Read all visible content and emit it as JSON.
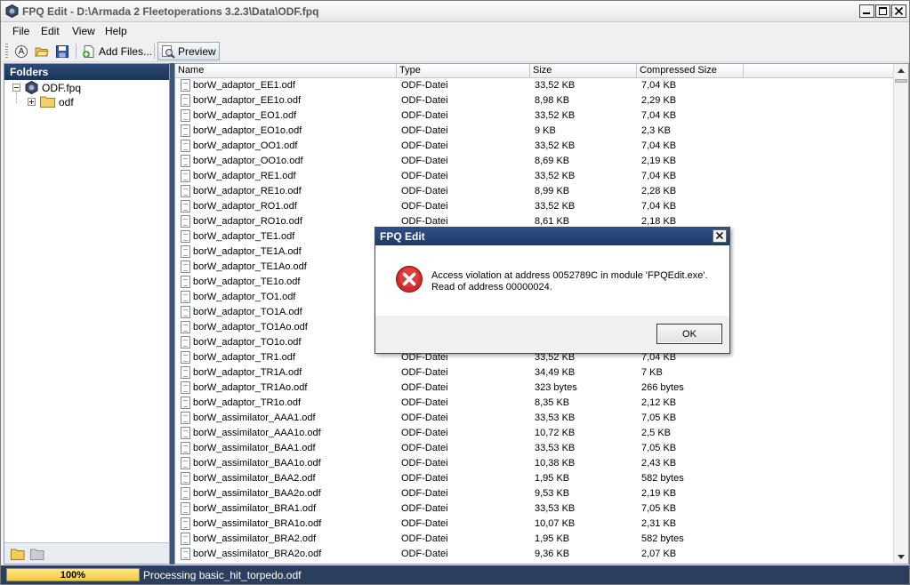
{
  "window": {
    "title": "FPQ Edit - D:\\Armada 2 Fleetoperations 3.2.3\\Data\\ODF.fpq"
  },
  "menu": [
    "File",
    "Edit",
    "View",
    "Help"
  ],
  "toolbar": {
    "add_files_label": "Add Files...",
    "preview_label": "Preview"
  },
  "folders": {
    "header": "Folders",
    "root_label": "ODF.fpq",
    "child_label": "odf"
  },
  "list": {
    "columns": [
      "Name",
      "Type",
      "Size",
      "Compressed Size"
    ],
    "rows": [
      [
        "borW_adaptor_EE1.odf",
        "ODF-Datei",
        "33,52 KB",
        "7,04 KB"
      ],
      [
        "borW_adaptor_EE1o.odf",
        "ODF-Datei",
        "8,98 KB",
        "2,29 KB"
      ],
      [
        "borW_adaptor_EO1.odf",
        "ODF-Datei",
        "33,52 KB",
        "7,04 KB"
      ],
      [
        "borW_adaptor_EO1o.odf",
        "ODF-Datei",
        "9 KB",
        "2,3 KB"
      ],
      [
        "borW_adaptor_OO1.odf",
        "ODF-Datei",
        "33,52 KB",
        "7,04 KB"
      ],
      [
        "borW_adaptor_OO1o.odf",
        "ODF-Datei",
        "8,69 KB",
        "2,19 KB"
      ],
      [
        "borW_adaptor_RE1.odf",
        "ODF-Datei",
        "33,52 KB",
        "7,04 KB"
      ],
      [
        "borW_adaptor_RE1o.odf",
        "ODF-Datei",
        "8,99 KB",
        "2,28 KB"
      ],
      [
        "borW_adaptor_RO1.odf",
        "ODF-Datei",
        "33,52 KB",
        "7,04 KB"
      ],
      [
        "borW_adaptor_RO1o.odf",
        "ODF-Datei",
        "8,61 KB",
        "2,18 KB"
      ],
      [
        "borW_adaptor_TE1.odf",
        "",
        "",
        ""
      ],
      [
        "borW_adaptor_TE1A.odf",
        "",
        "",
        ""
      ],
      [
        "borW_adaptor_TE1Ao.odf",
        "",
        "",
        ""
      ],
      [
        "borW_adaptor_TE1o.odf",
        "",
        "",
        ""
      ],
      [
        "borW_adaptor_TO1.odf",
        "",
        "",
        ""
      ],
      [
        "borW_adaptor_TO1A.odf",
        "",
        "",
        ""
      ],
      [
        "borW_adaptor_TO1Ao.odf",
        "",
        "",
        ""
      ],
      [
        "borW_adaptor_TO1o.odf",
        "",
        "",
        ""
      ],
      [
        "borW_adaptor_TR1.odf",
        "ODF-Datei",
        "33,52 KB",
        "7,04 KB"
      ],
      [
        "borW_adaptor_TR1A.odf",
        "ODF-Datei",
        "34,49 KB",
        "7 KB"
      ],
      [
        "borW_adaptor_TR1Ao.odf",
        "ODF-Datei",
        "323 bytes",
        "266 bytes"
      ],
      [
        "borW_adaptor_TR1o.odf",
        "ODF-Datei",
        "8,35 KB",
        "2,12 KB"
      ],
      [
        "borW_assimilator_AAA1.odf",
        "ODF-Datei",
        "33,53 KB",
        "7,05 KB"
      ],
      [
        "borW_assimilator_AAA1o.odf",
        "ODF-Datei",
        "10,72 KB",
        "2,5 KB"
      ],
      [
        "borW_assimilator_BAA1.odf",
        "ODF-Datei",
        "33,53 KB",
        "7,05 KB"
      ],
      [
        "borW_assimilator_BAA1o.odf",
        "ODF-Datei",
        "10,38 KB",
        "2,43 KB"
      ],
      [
        "borW_assimilator_BAA2.odf",
        "ODF-Datei",
        "1,95 KB",
        "582 bytes"
      ],
      [
        "borW_assimilator_BAA2o.odf",
        "ODF-Datei",
        "9,53 KB",
        "2,19 KB"
      ],
      [
        "borW_assimilator_BRA1.odf",
        "ODF-Datei",
        "33,53 KB",
        "7,05 KB"
      ],
      [
        "borW_assimilator_BRA1o.odf",
        "ODF-Datei",
        "10,07 KB",
        "2,31 KB"
      ],
      [
        "borW_assimilator_BRA2.odf",
        "ODF-Datei",
        "1,95 KB",
        "582 bytes"
      ],
      [
        "borW_assimilator_BRA2o.odf",
        "ODF-Datei",
        "9,36 KB",
        "2,07 KB"
      ]
    ]
  },
  "status": {
    "progress_text": "100%",
    "progress": 1.0,
    "message": "Processing basic_hit_torpedo.odf"
  },
  "dialog": {
    "title": "FPQ Edit",
    "line1": "Access violation at address 0052789C in module 'FPQEdit.exe'.",
    "line2": "Read of address 00000024.",
    "ok_label": "OK"
  },
  "colors": {
    "accent": "#2f5086",
    "error": "#d12a2a",
    "progress": "#f5c842"
  }
}
